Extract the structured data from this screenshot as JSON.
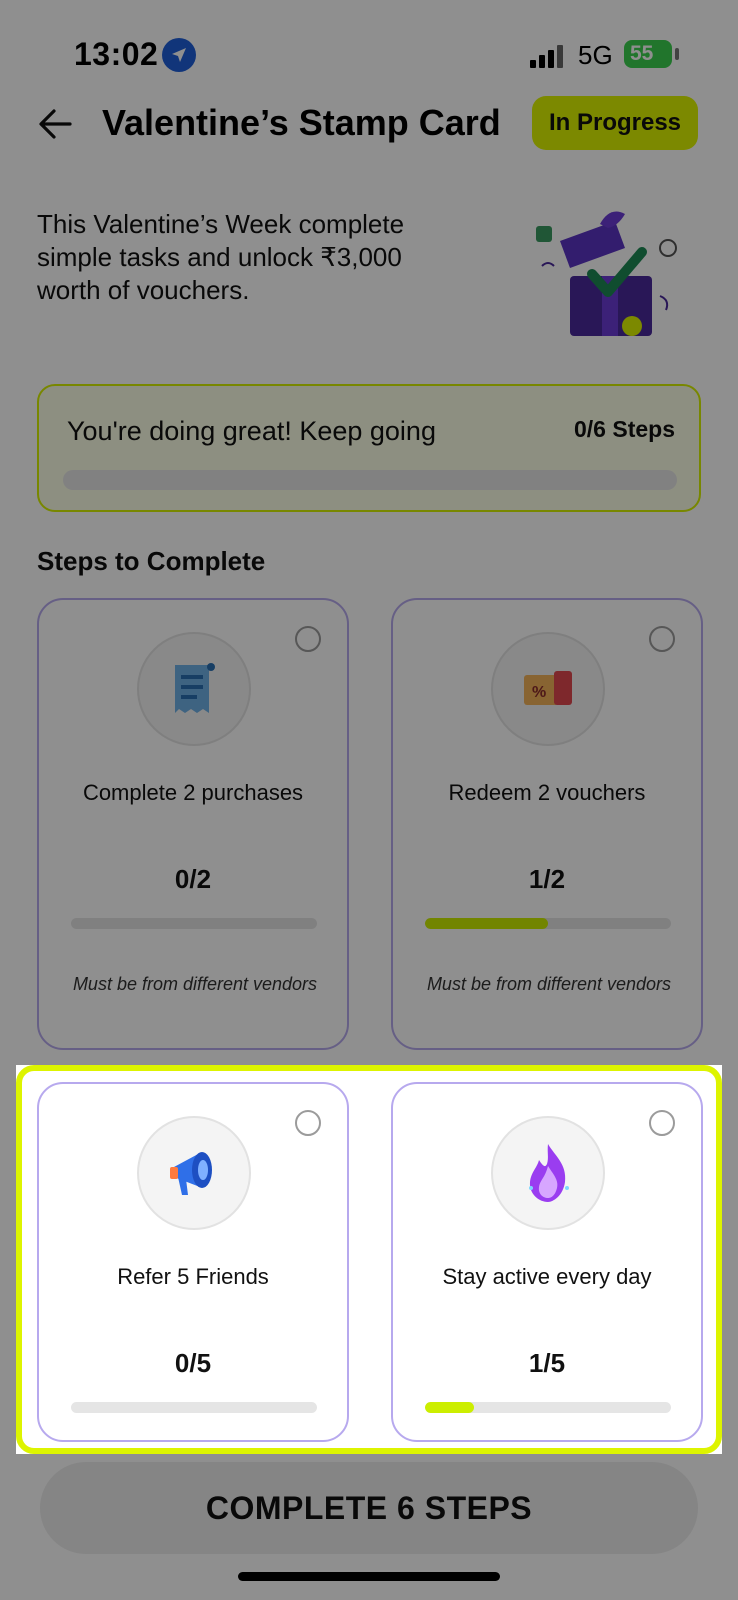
{
  "status_bar": {
    "time": "13:02",
    "network": "5G",
    "battery": "55"
  },
  "header": {
    "title": "Valentine’s Stamp Card",
    "status_badge": "In Progress"
  },
  "intro": {
    "text": "This Valentine’s Week complete simple tasks and unlock ₹3,000 worth of vouchers."
  },
  "progress": {
    "message": "You're doing great! Keep going",
    "steps_label": "0/6 Steps",
    "fraction": 0
  },
  "steps_section": {
    "title": "Steps to Complete",
    "steps": [
      {
        "title": "Complete 2 purchases",
        "count": "0/2",
        "fraction": 0,
        "note": "Must be from different vendors",
        "icon": "receipt-icon"
      },
      {
        "title": "Redeem 2 vouchers",
        "count": "1/2",
        "fraction": 0.5,
        "note": "Must be from different vendors",
        "icon": "voucher-icon"
      },
      {
        "title": "Refer 5 Friends",
        "count": "0/5",
        "fraction": 0,
        "icon": "megaphone-icon"
      },
      {
        "title": "Stay active every day",
        "count": "1/5",
        "fraction": 0.2,
        "icon": "fire-icon"
      }
    ]
  },
  "cta": {
    "label": "COMPLETE 6 STEPS"
  },
  "colors": {
    "accent": "#ccee00",
    "card_border": "#b7a9ee",
    "highlight": "#ddf400",
    "dim_overlay": "rgba(0,0,0,0.44)"
  }
}
